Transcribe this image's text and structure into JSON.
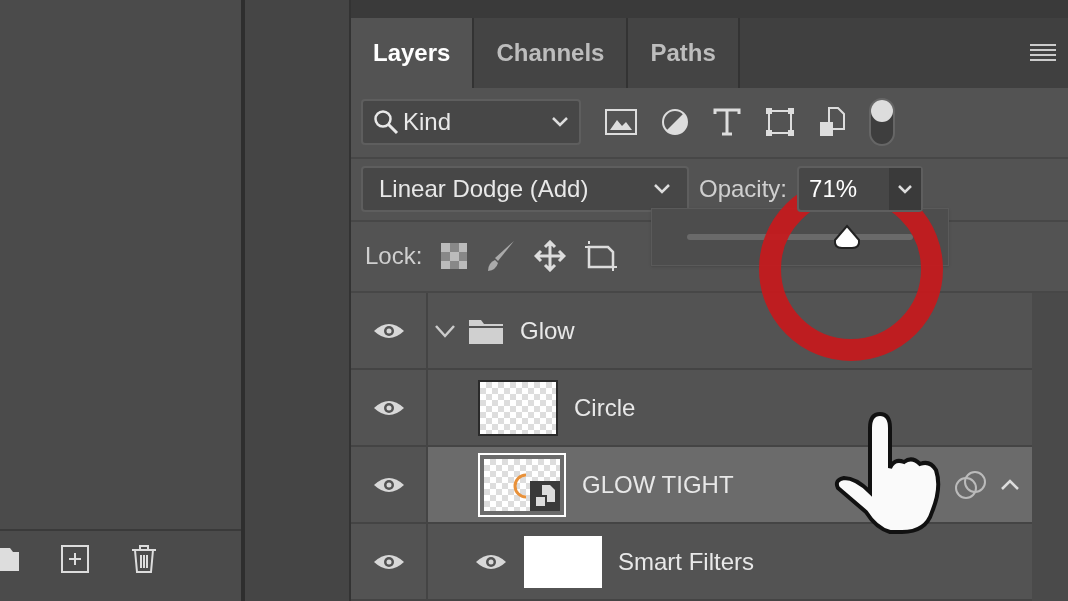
{
  "tabs": [
    {
      "label": "Layers",
      "selected": true
    },
    {
      "label": "Channels",
      "selected": false
    },
    {
      "label": "Paths",
      "selected": false
    }
  ],
  "filter": {
    "label": "Kind",
    "on": true
  },
  "blend_mode": "Linear Dodge (Add)",
  "opacity": {
    "label": "Opacity:",
    "value": "71%"
  },
  "opacity_slider": {
    "level": 0.71
  },
  "lock": {
    "label": "Lock:"
  },
  "layers": [
    {
      "name": "Glow",
      "kind": "group",
      "visible": true,
      "expanded": true,
      "selected": false,
      "children": [
        {
          "name": "Circle",
          "kind": "pixel",
          "visible": true,
          "selected": false
        },
        {
          "name": "GLOW TIGHT",
          "kind": "smart",
          "visible": true,
          "selected": true,
          "expanded": true,
          "children": [
            {
              "name": "Smart Filters",
              "kind": "filters",
              "visible": true,
              "selected": false
            }
          ]
        }
      ]
    }
  ]
}
